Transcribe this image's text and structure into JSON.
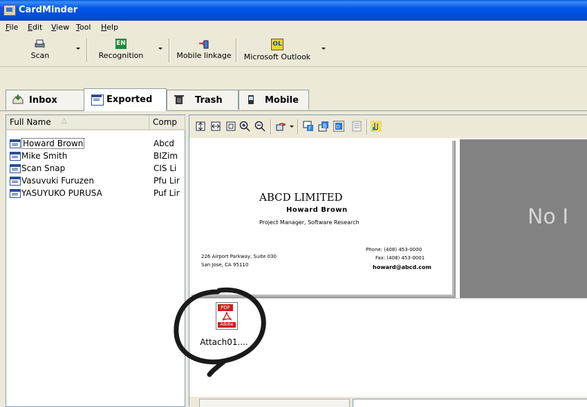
{
  "window": {
    "title": "CardMinder"
  },
  "menu": {
    "items": [
      {
        "accel": "F",
        "rest": "ile"
      },
      {
        "accel": "E",
        "rest": "dit"
      },
      {
        "accel": "V",
        "rest": "iew"
      },
      {
        "accel": "T",
        "rest": "ool"
      },
      {
        "accel": "H",
        "rest": "elp"
      }
    ]
  },
  "toolbar": {
    "scan": "Scan",
    "recognition": "Recognition",
    "mobile_linkage": "Mobile linkage",
    "outlook": "Microsoft Outlook",
    "recognition_badge": "EN",
    "outlook_badge": "OL"
  },
  "tabs": {
    "inbox": "Inbox",
    "exported": "Exported",
    "trash": "Trash",
    "mobile": "Mobile"
  },
  "list": {
    "headers": {
      "full_name": "Full Name",
      "company": "Comp"
    },
    "rows": [
      {
        "name": "Howard Brown",
        "company": "Abcd"
      },
      {
        "name": "Mike Smith",
        "company": "BIZim"
      },
      {
        "name": "Scan Snap",
        "company": "CIS Li"
      },
      {
        "name": "Vasuvuki Furuzen",
        "company": "Pfu Lir"
      },
      {
        "name": "YASUYUKO PURUSA",
        "company": "Puf Lir"
      }
    ]
  },
  "card": {
    "company": "ABCD LIMITED",
    "name": "Howard Brown",
    "title": "Project Manager, Software Research",
    "address1": "226 Airport Parkway, Suite 030",
    "address2": "San Jose, CA 95110",
    "phone": "Phone: (408) 453-0000",
    "fax": "Fax: (408) 453-0001",
    "email": "howard@abcd.com"
  },
  "no_image": "No I",
  "attachment": {
    "filename": "Attach01....",
    "badge": "PDF",
    "brand": "Adobe"
  },
  "colors": {
    "titlebar": "#0055e5",
    "annotation": "#1a1a1a",
    "no_image_bg": "#828282"
  }
}
